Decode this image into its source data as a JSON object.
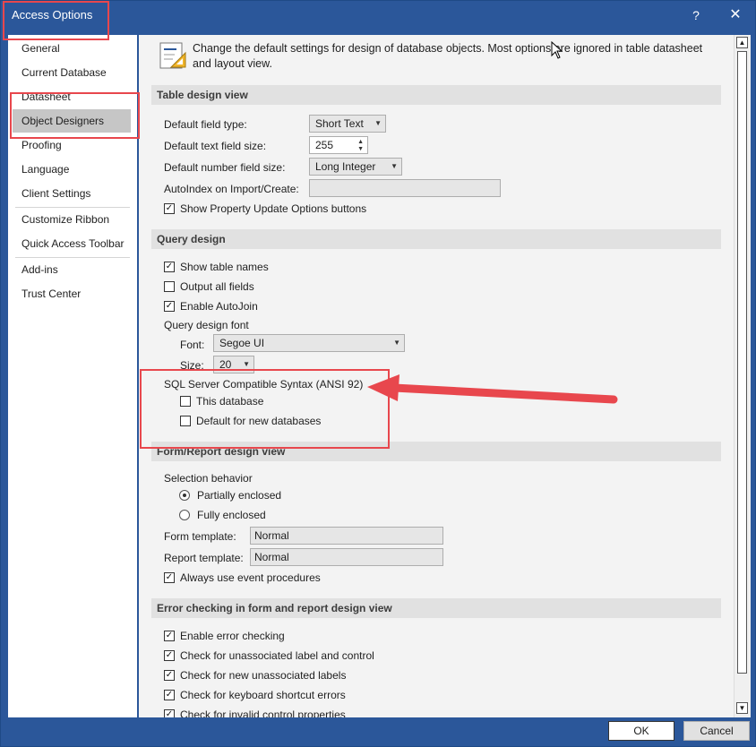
{
  "window": {
    "title": "Access Options",
    "help_glyph": "?",
    "close_glyph": "✕"
  },
  "sidebar": {
    "items": [
      {
        "label": "General"
      },
      {
        "label": "Current Database"
      },
      {
        "label": "Datasheet"
      },
      {
        "label": "Object Designers"
      },
      {
        "label": "Proofing"
      },
      {
        "label": "Language"
      },
      {
        "label": "Client Settings"
      },
      {
        "label": "Customize Ribbon"
      },
      {
        "label": "Quick Access Toolbar"
      },
      {
        "label": "Add-ins"
      },
      {
        "label": "Trust Center"
      }
    ]
  },
  "intro": "Change the default settings for design of database objects. Most options are ignored in table datasheet and layout view.",
  "table_design": {
    "header": "Table design view",
    "field_type_label": "Default field type:",
    "field_type_value": "Short Text",
    "text_size_label": "Default text field size:",
    "text_size_value": "255",
    "number_size_label": "Default number field size:",
    "number_size_value": "Long Integer",
    "autoindex_label": "AutoIndex on Import/Create:",
    "autoindex_value": "",
    "show_prop_label": "Show Property Update Options buttons"
  },
  "query_design": {
    "header": "Query design",
    "show_table_names": "Show table names",
    "output_all_fields": "Output all fields",
    "enable_autojoin": "Enable AutoJoin",
    "font_group_label": "Query design font",
    "font_label": "Font:",
    "font_value": "Segoe UI",
    "size_label": "Size:",
    "size_value": "20",
    "sql_label": "SQL Server Compatible Syntax (ANSI 92)",
    "this_database": "This database",
    "default_new_db": "Default for new databases"
  },
  "form_report": {
    "header": "Form/Report design view",
    "selection_behavior": "Selection behavior",
    "partially_enclosed": "Partially enclosed",
    "fully_enclosed": "Fully enclosed",
    "form_template_label": "Form template:",
    "form_template_value": "Normal",
    "report_template_label": "Report template:",
    "report_template_value": "Normal",
    "always_event": "Always use event procedures"
  },
  "error_checking": {
    "header": "Error checking in form and report design view",
    "enable": "Enable error checking",
    "unassociated": "Check for unassociated label and control",
    "new_unassociated": "Check for new unassociated labels",
    "keyboard": "Check for keyboard shortcut errors",
    "invalid": "Check for invalid control properties"
  },
  "buttons": {
    "ok": "OK",
    "cancel": "Cancel"
  },
  "check_glyph": "✓",
  "colors": {
    "title_bar": "#2b579a",
    "annotation_red": "#e8474d",
    "selected_nav": "#c6c6c6"
  }
}
